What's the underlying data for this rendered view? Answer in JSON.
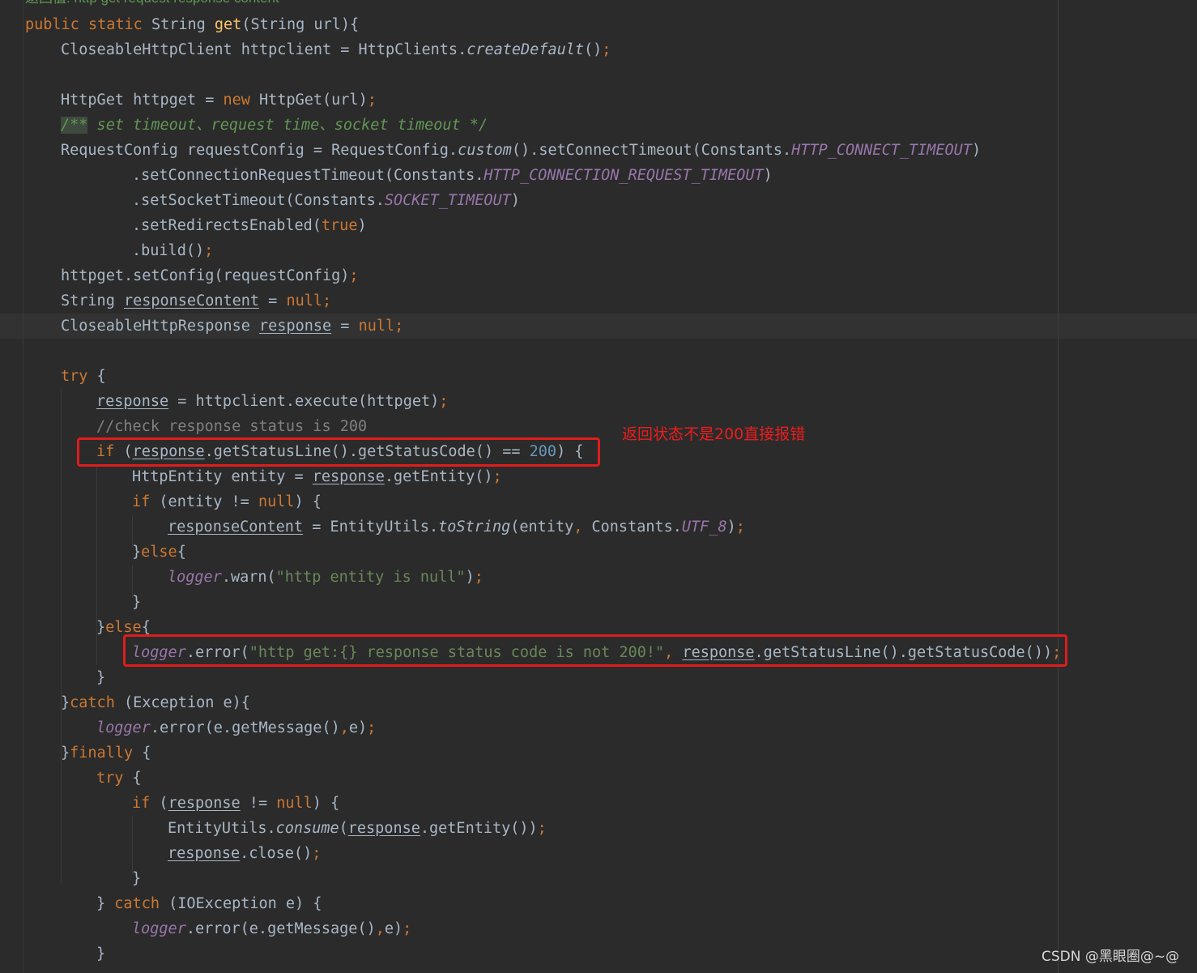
{
  "code": {
    "top_cut": "返回值: http get request response content",
    "l1": {
      "k1": "public static ",
      "t1": "String ",
      "f": "get",
      "t2": "(String url){"
    },
    "l2": {
      "t1": "CloseableHttpClient httpclient = HttpClients.",
      "m": "createDefault",
      "t2": "()",
      "s": ";"
    },
    "l4": {
      "t1": "HttpGet httpget = ",
      "k": "new ",
      "t2": "HttpGet(url)",
      "s": ";"
    },
    "l5": {
      "mark": "/**",
      "rest": " set timeout、request time、socket timeout */"
    },
    "l6": {
      "t1": "RequestConfig requestConfig = RequestConfig.",
      "m": "custom",
      "t2": "().setConnectTimeout(Constants.",
      "c": "HTTP_CONNECT_TIMEOUT",
      "t3": ")"
    },
    "l7": {
      "t1": ".setConnectionRequestTimeout(Constants.",
      "c": "HTTP_CONNECTION_REQUEST_TIMEOUT",
      "t2": ")"
    },
    "l8": {
      "t1": ".setSocketTimeout(Constants.",
      "c": "SOCKET_TIMEOUT",
      "t2": ")"
    },
    "l9": {
      "t1": ".setRedirectsEnabled(",
      "k": "true",
      "t2": ")"
    },
    "l10": {
      "t1": ".build()",
      "s": ";"
    },
    "l11": {
      "t1": "httpget.setConfig(requestConfig)",
      "s": ";"
    },
    "l12": {
      "t1": "String ",
      "v": "responseContent",
      "t2": " = ",
      "k": "null;"
    },
    "l13": {
      "t1": "CloseableHttpResponse ",
      "v": "response",
      "t2": " = ",
      "k": "null;"
    },
    "l15": {
      "k": "try",
      "t1": " {"
    },
    "l16": {
      "v": "response",
      "t1": " = httpclient.execute(httpget)",
      "s": ";"
    },
    "l17": {
      "c": "//check response status is 200"
    },
    "l18": {
      "k": "if",
      "t1": " (",
      "v": "response",
      "t2": ".getStatusLine().getStatusCode() == ",
      "n": "200",
      "t3": ") {"
    },
    "l19": {
      "t1": "HttpEntity entity = ",
      "v": "response",
      "t2": ".getEntity()",
      "s": ";"
    },
    "l20": {
      "k1": "if",
      "t1": " (entity != ",
      "k2": "null",
      "t2": ") {"
    },
    "l21": {
      "v": "responseContent",
      "t1": " = EntityUtils.",
      "m": "toString",
      "t2": "(entity",
      "s1": ",",
      "t3": " Constants.",
      "c": "UTF_8",
      "t4": ")",
      "s2": ";"
    },
    "l22": {
      "t1": "}",
      "k": "else",
      "t2": "{"
    },
    "l23": {
      "lg": "logger",
      "t1": ".warn(",
      "str": "\"http entity is null\"",
      "t2": ")",
      "s": ";"
    },
    "l24": {
      "t1": "}"
    },
    "l25": {
      "t1": "}",
      "k": "else",
      "t2": "{"
    },
    "l26": {
      "lg": "logger",
      "t1": ".error(",
      "str": "\"http get:{} response status code is not 200!\"",
      "s1": ",",
      "t2": " ",
      "v": "response",
      "t3": ".getStatusLine().getStatusCode())",
      "s2": ";"
    },
    "l27": {
      "t1": "}"
    },
    "l28": {
      "t1": "}",
      "k": "catch",
      "t2": " (Exception e){"
    },
    "l29": {
      "lg": "logger",
      "t1": ".error(e.getMessage()",
      "s1": ",",
      "t2": "e)",
      "s2": ";"
    },
    "l30": {
      "t1": "}",
      "k": "finally",
      "t2": " {"
    },
    "l31": {
      "k": "try",
      "t1": " {"
    },
    "l32": {
      "k1": "if",
      "t1": " (",
      "v": "response",
      "t2": " != ",
      "k2": "null",
      "t3": ") {"
    },
    "l33": {
      "t1": "EntityUtils.",
      "m": "consume",
      "t2": "(",
      "v": "response",
      "t3": ".getEntity())",
      "s": ";"
    },
    "l34": {
      "v": "response",
      "t1": ".close()",
      "s": ";"
    },
    "l35": {
      "t1": "}"
    },
    "l36": {
      "t1": "} ",
      "k": "catch",
      "t2": " (IOException e) {"
    },
    "l37": {
      "lg": "logger",
      "t1": ".error(e.getMessage()",
      "s1": ",",
      "t2": "e)",
      "s2": ";"
    },
    "l38": {
      "t1": "}"
    }
  },
  "annotation": "返回状态不是200直接报错",
  "watermark": "CSDN @黑眼圈@~@",
  "colors": {
    "background": "#2b2b2b",
    "keyword": "#cc7832",
    "method_decl": "#ffc66d",
    "string": "#6a8759",
    "number": "#6897bb",
    "constant": "#9876aa",
    "comment": "#808080",
    "highlight_box": "#e01c1c"
  }
}
